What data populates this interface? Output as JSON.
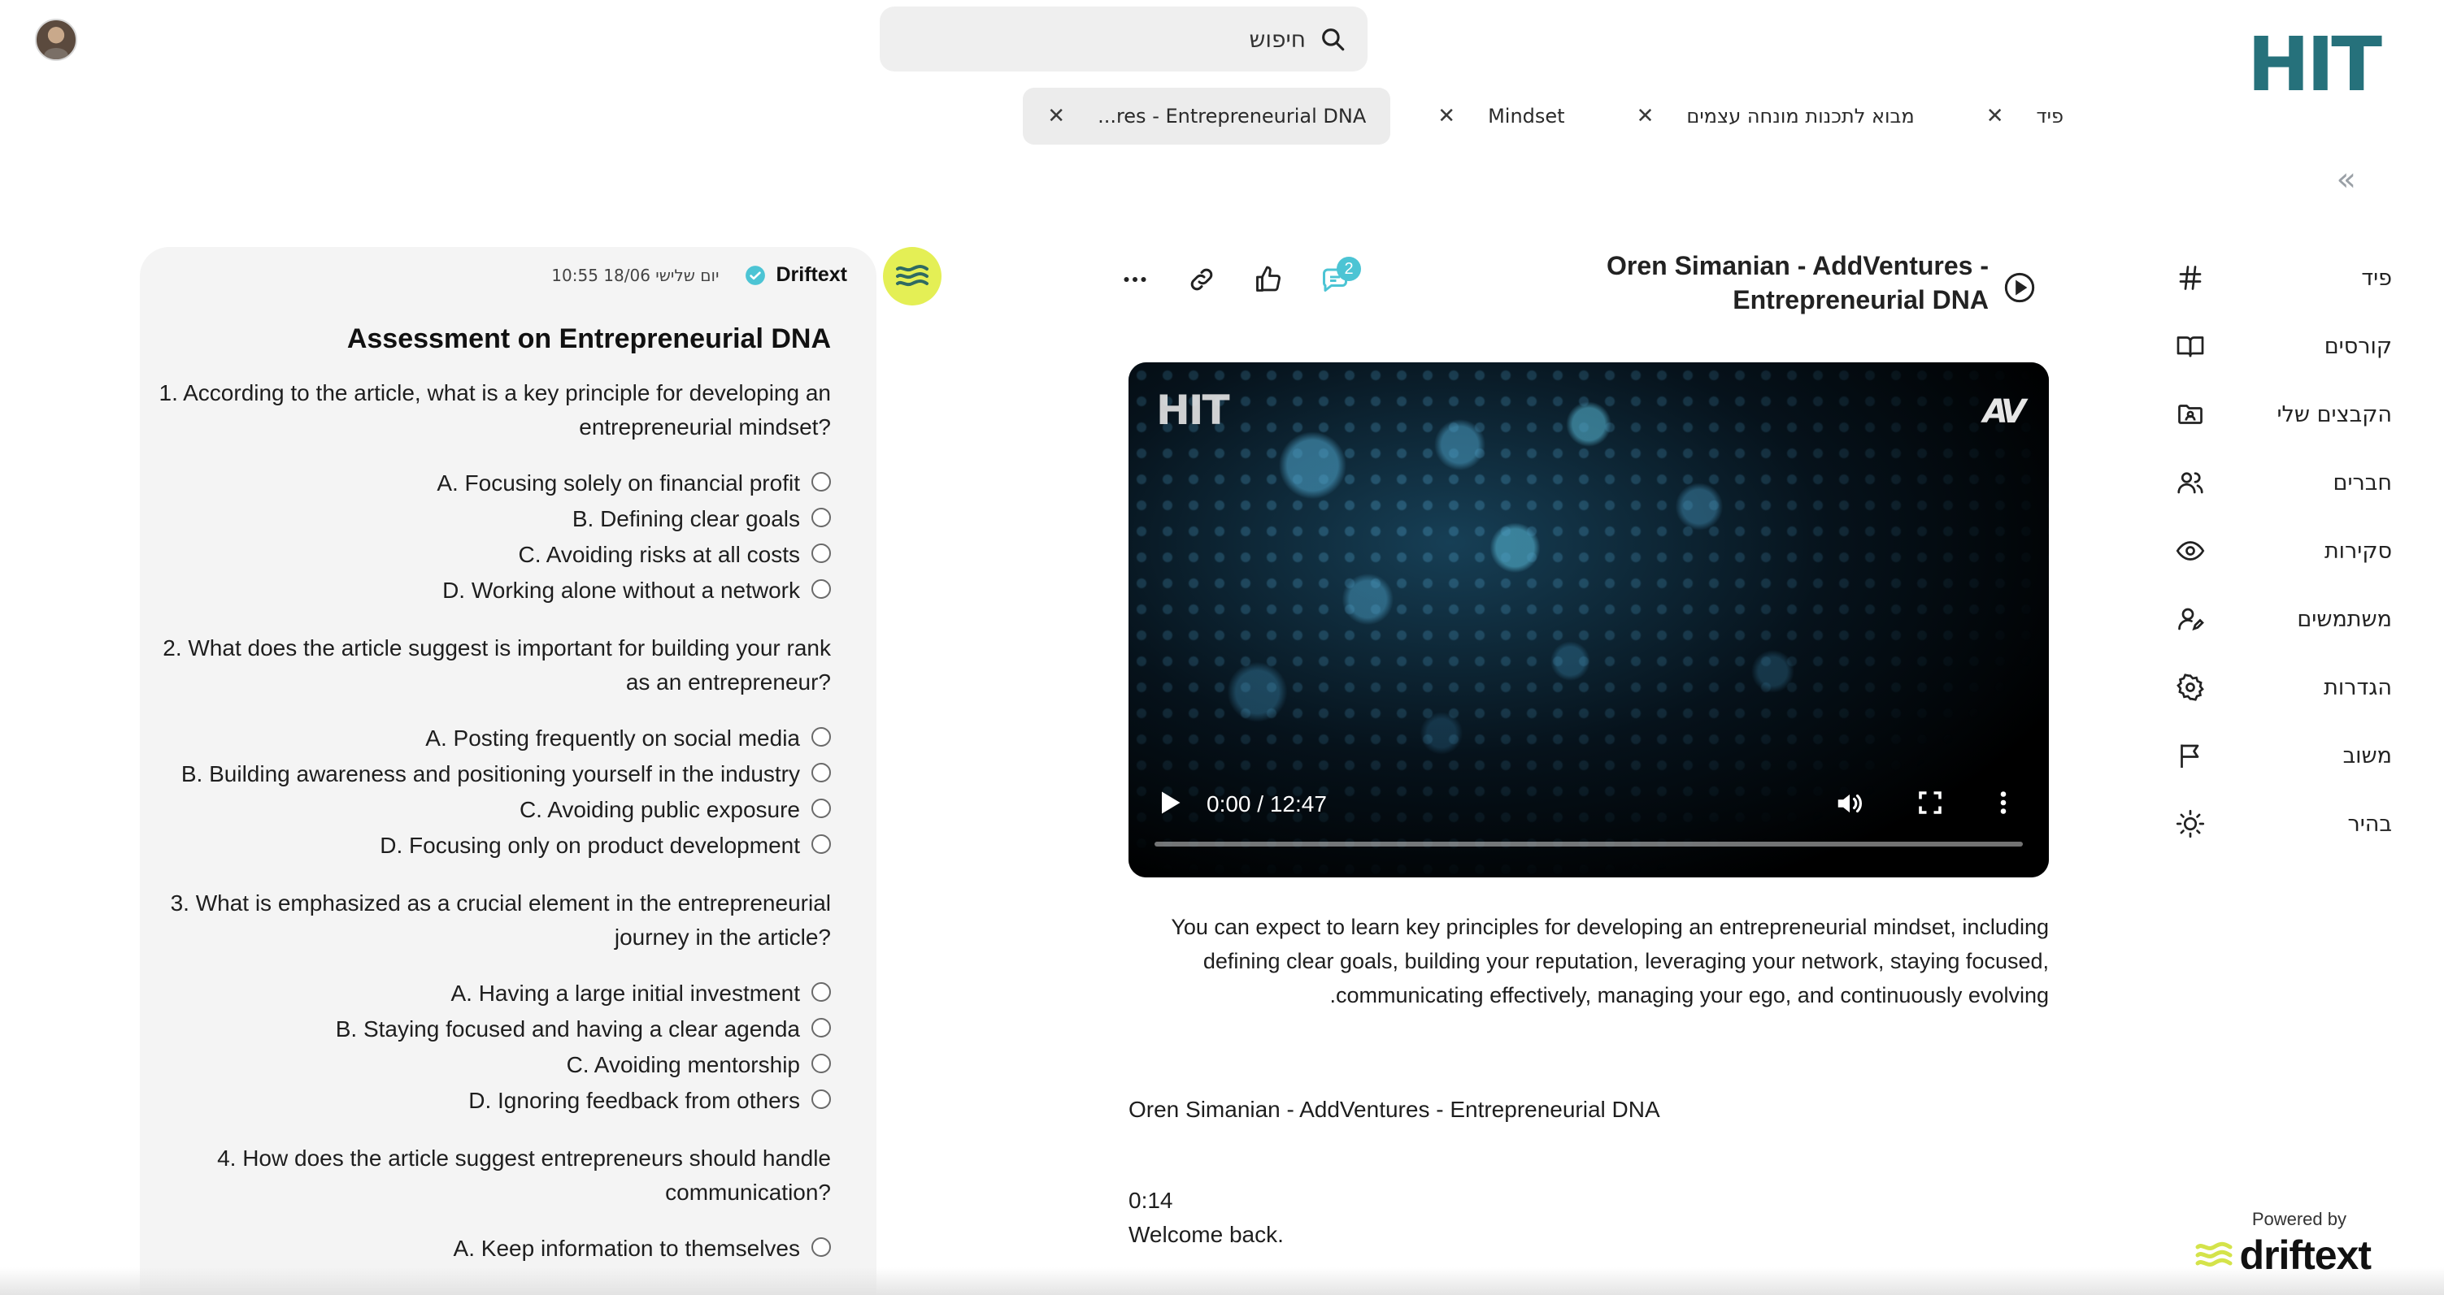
{
  "search": {
    "placeholder": "חיפוש"
  },
  "tabs": [
    {
      "label": "פיד"
    },
    {
      "label": "מבוא לתכנות מונחה עצמים"
    },
    {
      "label": "Mindset"
    },
    {
      "label": "...res - Entrepreneurial DNA",
      "active": true
    }
  ],
  "logo": {
    "text": "HIT"
  },
  "sidebar": {
    "collapse_label": "«",
    "items": [
      {
        "label": "פיד",
        "icon": "hash-icon"
      },
      {
        "label": "קורסים",
        "icon": "book-icon"
      },
      {
        "label": "הקבצים שלי",
        "icon": "folder-user-icon"
      },
      {
        "label": "חברים",
        "icon": "users-icon"
      },
      {
        "label": "סקירות",
        "icon": "eye-icon"
      },
      {
        "label": "משתמשים",
        "icon": "user-edit-icon"
      },
      {
        "label": "הגדרות",
        "icon": "gear-icon"
      },
      {
        "label": "משוב",
        "icon": "flag-icon"
      },
      {
        "label": "בהיר",
        "icon": "sun-icon"
      }
    ]
  },
  "powered": {
    "by": "Powered by",
    "brand": "driftext"
  },
  "video": {
    "title": "Oren Simanian - AddVentures - Entrepreneurial DNA",
    "comments_count": "2",
    "time": "0:00 / 12:47",
    "progress": 0,
    "logo_left": "HIT",
    "logo_right": "AV"
  },
  "description": "You can expect to learn key principles for developing an entrepreneurial mindset, including defining clear goals, building your reputation, leveraging your network, staying focused, communicating effectively, managing your ego, and continuously evolving.",
  "transcript": {
    "title": "Oren Simanian - AddVentures - Entrepreneurial DNA",
    "time": "0:14",
    "text": "Welcome back."
  },
  "assessment": {
    "author": "Driftext",
    "timestamp": "יום שלישי 18/06 10:55",
    "title": "Assessment on Entrepreneurial DNA",
    "questions": [
      {
        "text": "1. According to the article, what is a key principle for developing an entrepreneurial mindset?",
        "options": [
          "A. Focusing solely on financial profit",
          "B. Defining clear goals",
          "C. Avoiding risks at all costs",
          "D. Working alone without a network"
        ]
      },
      {
        "text": "2. What does the article suggest is important for building your rank as an entrepreneur?",
        "options": [
          "A. Posting frequently on social media",
          "B. Building awareness and positioning yourself in the industry",
          "C. Avoiding public exposure",
          "D. Focusing only on product development"
        ]
      },
      {
        "text": "3. What is emphasized as a crucial element in the entrepreneurial journey in the article?",
        "options": [
          "A. Having a large initial investment",
          "B. Staying focused and having a clear agenda",
          "C. Avoiding mentorship",
          "D. Ignoring feedback from others"
        ]
      },
      {
        "text": "4. How does the article suggest entrepreneurs should handle communication?",
        "options": [
          "A. Keep information to themselves"
        ]
      }
    ]
  },
  "colors": {
    "brand": "#26717b",
    "accent": "#4cc4d4",
    "driftext": "#e4ef55"
  }
}
